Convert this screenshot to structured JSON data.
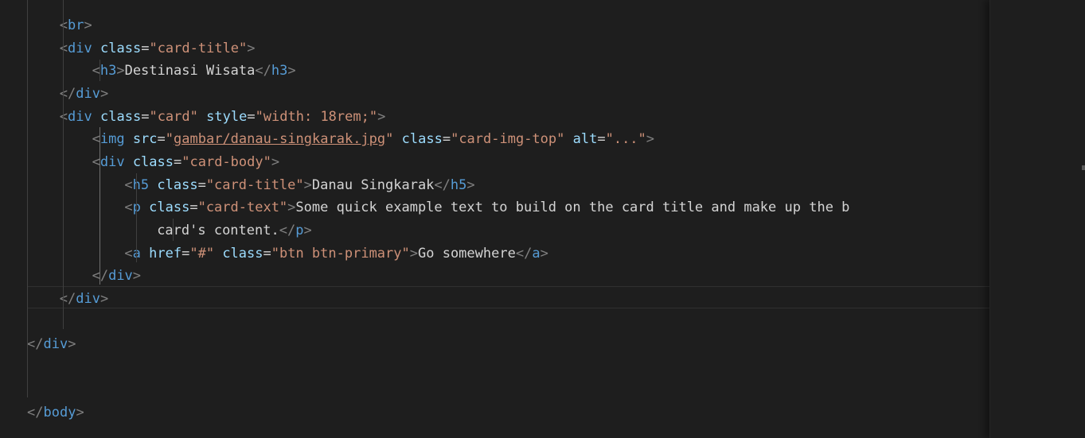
{
  "editor": {
    "lines": [
      {
        "indent": 2,
        "tokens": [
          [
            "punc",
            "<"
          ],
          [
            "tag",
            "br"
          ],
          [
            "punc",
            ">"
          ]
        ]
      },
      {
        "indent": 2,
        "tokens": [
          [
            "punc",
            "<"
          ],
          [
            "tag",
            "div"
          ],
          [
            "text",
            " "
          ],
          [
            "attr",
            "class"
          ],
          [
            "text",
            "="
          ],
          [
            "str",
            "\"card-title\""
          ],
          [
            "punc",
            ">"
          ]
        ]
      },
      {
        "indent": 3,
        "tokens": [
          [
            "punc",
            "<"
          ],
          [
            "tag",
            "h3"
          ],
          [
            "punc",
            ">"
          ],
          [
            "text",
            "Destinasi Wisata"
          ],
          [
            "punc",
            "</"
          ],
          [
            "tag",
            "h3"
          ],
          [
            "punc",
            ">"
          ]
        ]
      },
      {
        "indent": 2,
        "tokens": [
          [
            "punc",
            "</"
          ],
          [
            "tag",
            "div"
          ],
          [
            "punc",
            ">"
          ]
        ]
      },
      {
        "indent": 2,
        "tokens": [
          [
            "punc",
            "<"
          ],
          [
            "tag",
            "div"
          ],
          [
            "text",
            " "
          ],
          [
            "attr",
            "class"
          ],
          [
            "text",
            "="
          ],
          [
            "str",
            "\"card\""
          ],
          [
            "text",
            " "
          ],
          [
            "attr",
            "style"
          ],
          [
            "text",
            "="
          ],
          [
            "str",
            "\"width: 18rem;\""
          ],
          [
            "punc",
            ">"
          ]
        ]
      },
      {
        "indent": 3,
        "tokens": [
          [
            "punc",
            "<"
          ],
          [
            "tag",
            "img"
          ],
          [
            "text",
            " "
          ],
          [
            "attr",
            "src"
          ],
          [
            "text",
            "="
          ],
          [
            "str",
            "\""
          ],
          [
            "link",
            "gambar/danau-singkarak.jpg"
          ],
          [
            "str",
            "\""
          ],
          [
            "text",
            " "
          ],
          [
            "attr",
            "class"
          ],
          [
            "text",
            "="
          ],
          [
            "str",
            "\"card-img-top\""
          ],
          [
            "text",
            " "
          ],
          [
            "attr",
            "alt"
          ],
          [
            "text",
            "="
          ],
          [
            "str",
            "\"...\""
          ],
          [
            "punc",
            ">"
          ]
        ]
      },
      {
        "indent": 3,
        "tokens": [
          [
            "punc",
            "<"
          ],
          [
            "tag",
            "div"
          ],
          [
            "text",
            " "
          ],
          [
            "attr",
            "class"
          ],
          [
            "text",
            "="
          ],
          [
            "str",
            "\"card-body\""
          ],
          [
            "punc",
            ">"
          ]
        ]
      },
      {
        "indent": 4,
        "tokens": [
          [
            "punc",
            "<"
          ],
          [
            "tag",
            "h5"
          ],
          [
            "text",
            " "
          ],
          [
            "attr",
            "class"
          ],
          [
            "text",
            "="
          ],
          [
            "str",
            "\"card-title\""
          ],
          [
            "punc",
            ">"
          ],
          [
            "text",
            "Danau Singkarak"
          ],
          [
            "punc",
            "</"
          ],
          [
            "tag",
            "h5"
          ],
          [
            "punc",
            ">"
          ]
        ]
      },
      {
        "indent": 4,
        "tokens": [
          [
            "punc",
            "<"
          ],
          [
            "tag",
            "p"
          ],
          [
            "text",
            " "
          ],
          [
            "attr",
            "class"
          ],
          [
            "text",
            "="
          ],
          [
            "str",
            "\"card-text\""
          ],
          [
            "punc",
            ">"
          ],
          [
            "text",
            "Some quick example text to build on the card title and make up the b"
          ]
        ]
      },
      {
        "indent": 5,
        "tokens": [
          [
            "text",
            "card's content."
          ],
          [
            "punc",
            "</"
          ],
          [
            "tag",
            "p"
          ],
          [
            "punc",
            ">"
          ]
        ]
      },
      {
        "indent": 4,
        "tokens": [
          [
            "punc",
            "<"
          ],
          [
            "tag",
            "a"
          ],
          [
            "text",
            " "
          ],
          [
            "attr",
            "href"
          ],
          [
            "text",
            "="
          ],
          [
            "str",
            "\"#\""
          ],
          [
            "text",
            " "
          ],
          [
            "attr",
            "class"
          ],
          [
            "text",
            "="
          ],
          [
            "str",
            "\"btn btn-primary\""
          ],
          [
            "punc",
            ">"
          ],
          [
            "text",
            "Go somewhere"
          ],
          [
            "punc",
            "</"
          ],
          [
            "tag",
            "a"
          ],
          [
            "punc",
            ">"
          ]
        ]
      },
      {
        "indent": 3,
        "tokens": [
          [
            "punc",
            "</"
          ],
          [
            "tag",
            "div"
          ],
          [
            "punc",
            ">"
          ]
        ]
      },
      {
        "indent": 2,
        "tokens": [
          [
            "punc",
            "</"
          ],
          [
            "tag",
            "div"
          ],
          [
            "punc",
            ">"
          ]
        ]
      },
      {
        "indent": 0,
        "tokens": []
      },
      {
        "indent": 1,
        "tokens": [
          [
            "punc",
            "</"
          ],
          [
            "tag",
            "div"
          ],
          [
            "punc",
            ">"
          ]
        ]
      },
      {
        "indent": 0,
        "tokens": []
      },
      {
        "indent": 0,
        "tokens": []
      },
      {
        "indent": 0,
        "tokens": [
          [
            "punc",
            "</"
          ],
          [
            "tag",
            "body"
          ],
          [
            "punc",
            ">"
          ]
        ]
      }
    ],
    "current_line": 12,
    "colors": {
      "background": "#1e1e1e",
      "tag": "#569cd6",
      "attribute": "#9cdcfe",
      "string": "#ce9178",
      "punctuation": "#808080",
      "text": "#d4d4d4"
    }
  }
}
